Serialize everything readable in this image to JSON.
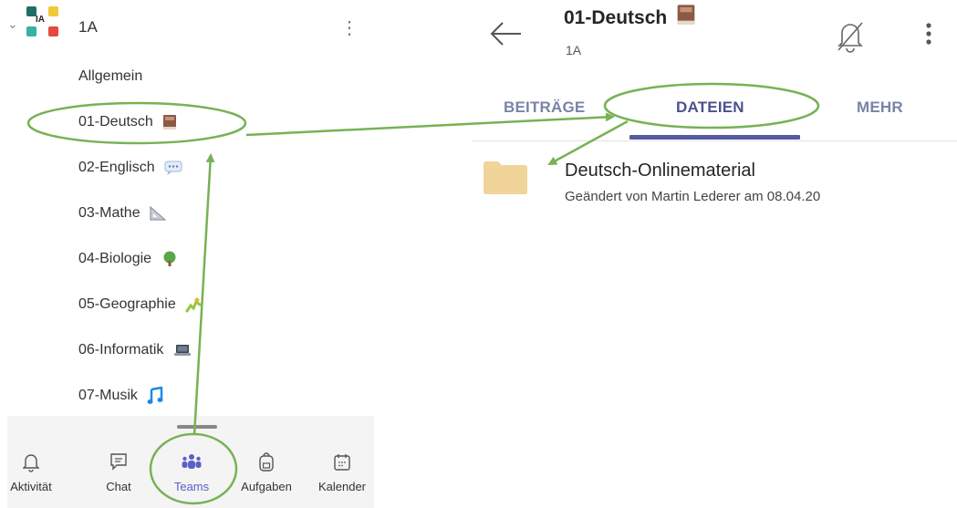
{
  "team": {
    "name": "1A",
    "more_icon": "more-vertical-icon",
    "logo_text": "IA"
  },
  "channels": [
    {
      "label": "Allgemein",
      "emoji": ""
    },
    {
      "label": "01-Deutsch",
      "emoji": "book-icon"
    },
    {
      "label": "02-Englisch",
      "emoji": "speech-bubble-icon"
    },
    {
      "label": "03-Mathe",
      "emoji": "triangle-ruler-icon"
    },
    {
      "label": "04-Biologie",
      "emoji": "tree-icon"
    },
    {
      "label": "05-Geographie",
      "emoji": "map-icon"
    },
    {
      "label": "06-Informatik",
      "emoji": "laptop-icon"
    },
    {
      "label": "07-Musik",
      "emoji": "music-note-icon"
    }
  ],
  "bottom_nav": [
    {
      "label": "Aktivität",
      "icon": "bell-icon",
      "active": false
    },
    {
      "label": "Chat",
      "icon": "chat-icon",
      "active": false
    },
    {
      "label": "Teams",
      "icon": "teams-icon",
      "active": true
    },
    {
      "label": "Aufgaben",
      "icon": "backpack-icon",
      "active": false
    },
    {
      "label": "Kalender",
      "icon": "calendar-icon",
      "active": false
    }
  ],
  "channel_view": {
    "title": "01-Deutsch",
    "subtitle": "1A",
    "tabs": [
      {
        "label": "BEITRÄGE",
        "active": false
      },
      {
        "label": "DATEIEN",
        "active": true
      },
      {
        "label": "MEHR",
        "active": false
      }
    ],
    "files": [
      {
        "name": "Deutsch-Onlinematerial",
        "meta": "Geändert von Martin Lederer am 08.04.20",
        "icon": "folder-icon"
      }
    ]
  },
  "colors": {
    "accent": "#5b5fc7",
    "tab_active": "#4d518e",
    "tab_inactive": "#7b83a8",
    "annotation": "#77b255",
    "folder": "#f0d49a"
  }
}
